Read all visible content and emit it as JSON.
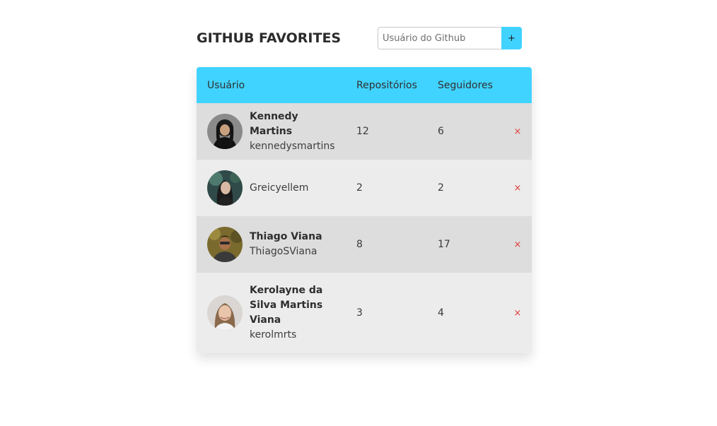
{
  "header": {
    "title": "GITHUB FAVORITES",
    "search_placeholder": "Usuário do Github",
    "add_label": "+"
  },
  "table": {
    "columns": [
      "Usuário",
      "Repositórios",
      "Seguidores"
    ],
    "remove_label": "×",
    "rows": [
      {
        "name": "Kennedy Martins",
        "login": "kennedysmartins",
        "repos": "12",
        "followers": "6"
      },
      {
        "name": "",
        "login": "Greicyellem",
        "repos": "2",
        "followers": "2"
      },
      {
        "name": "Thiago Viana",
        "login": "ThiagoSViana",
        "repos": "8",
        "followers": "17"
      },
      {
        "name": "Kerolayne da Silva Martins Viana",
        "login": "kerolmrts",
        "repos": "3",
        "followers": "4"
      }
    ]
  },
  "colors": {
    "accent": "#40d3ff",
    "row_dark": "#dddddd",
    "row_light": "#ececec",
    "remove": "#e0403a"
  }
}
